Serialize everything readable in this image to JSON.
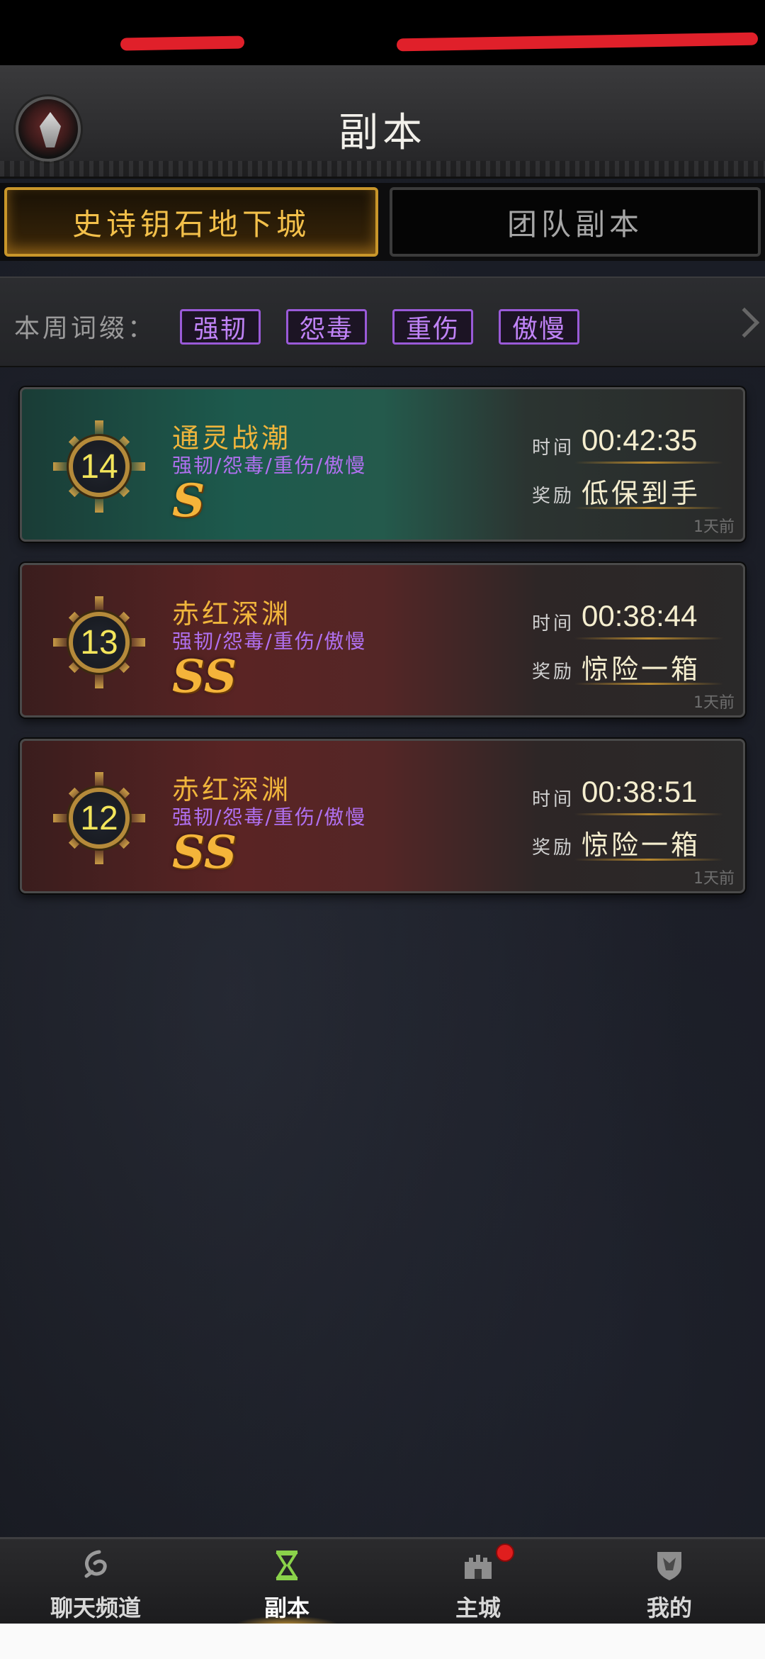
{
  "header": {
    "title": "副本"
  },
  "tabs": [
    {
      "label": "史诗钥石地下城",
      "active": true
    },
    {
      "label": "团队副本",
      "active": false
    }
  ],
  "affix_bar": {
    "label": "本周词缀：",
    "affixes": [
      "强韧",
      "怨毒",
      "重伤",
      "傲慢"
    ]
  },
  "runs": [
    {
      "level": "14",
      "dungeon": "通灵战潮",
      "affixes": "强韧/怨毒/重伤/傲慢",
      "rank": "S",
      "time_label": "时间",
      "time": "00:42:35",
      "reward_label": "奖励",
      "reward": "低保到手",
      "ago": "1天前",
      "theme": "teal"
    },
    {
      "level": "13",
      "dungeon": "赤红深渊",
      "affixes": "强韧/怨毒/重伤/傲慢",
      "rank": "SS",
      "time_label": "时间",
      "time": "00:38:44",
      "reward_label": "奖励",
      "reward": "惊险一箱",
      "ago": "1天前",
      "theme": "red"
    },
    {
      "level": "12",
      "dungeon": "赤红深渊",
      "affixes": "强韧/怨毒/重伤/傲慢",
      "rank": "SS",
      "time_label": "时间",
      "time": "00:38:51",
      "reward_label": "奖励",
      "reward": "惊险一箱",
      "ago": "1天前",
      "theme": "red"
    }
  ],
  "bottom_nav": [
    {
      "label": "聊天频道",
      "icon": "chat-swirl-icon",
      "active": false
    },
    {
      "label": "副本",
      "icon": "hourglass-icon",
      "active": true
    },
    {
      "label": "主城",
      "icon": "castle-icon",
      "active": false,
      "notification": true
    },
    {
      "label": "我的",
      "icon": "shield-crest-icon",
      "active": false
    }
  ],
  "colors": {
    "accent_gold": "#f0b53c",
    "affix_purple": "#b070f0",
    "notification_red": "#e01e1e"
  }
}
